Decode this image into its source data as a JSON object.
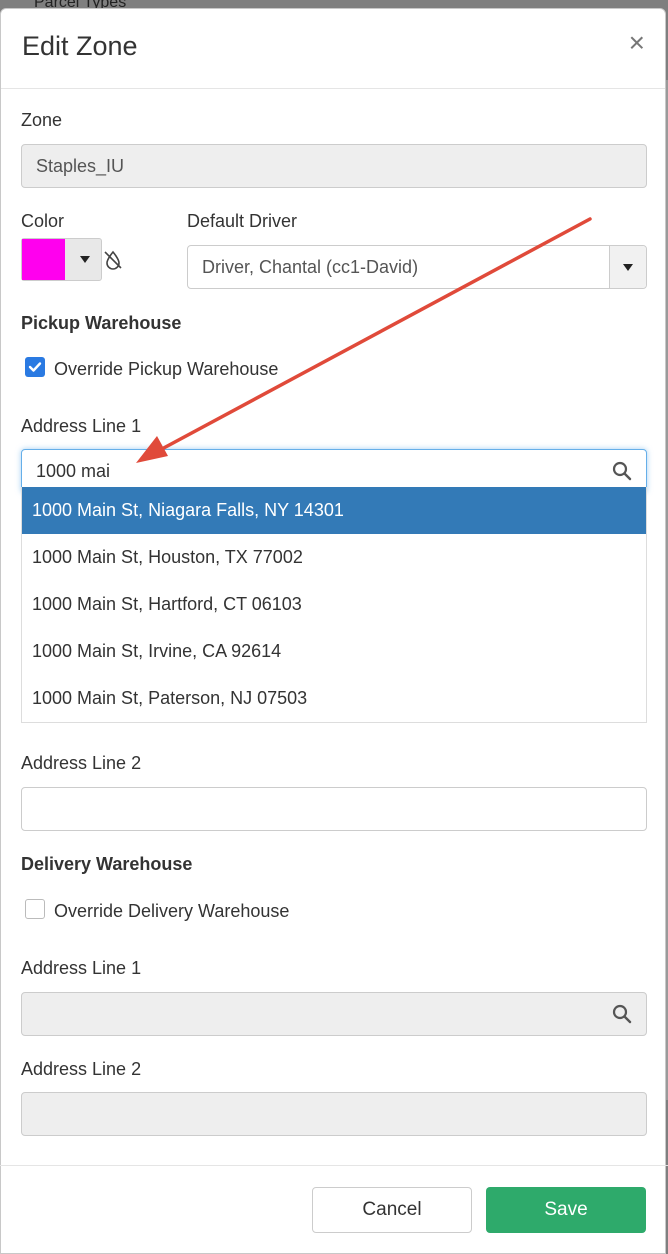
{
  "background": {
    "partial_text": "Parcel Types"
  },
  "modal": {
    "title": "Edit Zone",
    "close_symbol": "×",
    "zone": {
      "label": "Zone",
      "value": "Staples_IU"
    },
    "color": {
      "label": "Color",
      "value": "#ff00ee"
    },
    "default_driver": {
      "label": "Default Driver",
      "value": "Driver, Chantal (cc1-David)"
    },
    "pickup": {
      "section": "Pickup Warehouse",
      "override_label": "Override Pickup Warehouse",
      "override_checked": true,
      "address1_label": "Address Line 1",
      "address1_value": "1000 mai",
      "suggestions": [
        "1000 Main St, Niagara Falls, NY 14301",
        "1000 Main St, Houston, TX 77002",
        "1000 Main St, Hartford, CT 06103",
        "1000 Main St, Irvine, CA 92614",
        "1000 Main St, Paterson, NJ 07503"
      ],
      "address2_label": "Address Line 2",
      "address2_value": ""
    },
    "delivery": {
      "section": "Delivery Warehouse",
      "override_label": "Override Delivery Warehouse",
      "override_checked": false,
      "address1_label": "Address Line 1",
      "address2_label": "Address Line 2"
    },
    "footer": {
      "cancel": "Cancel",
      "save": "Save"
    }
  },
  "colors": {
    "primary": "#337ab7",
    "save": "#2eaa6b",
    "arrow": "#e04a3a",
    "checkbox": "#2a7ae2"
  }
}
